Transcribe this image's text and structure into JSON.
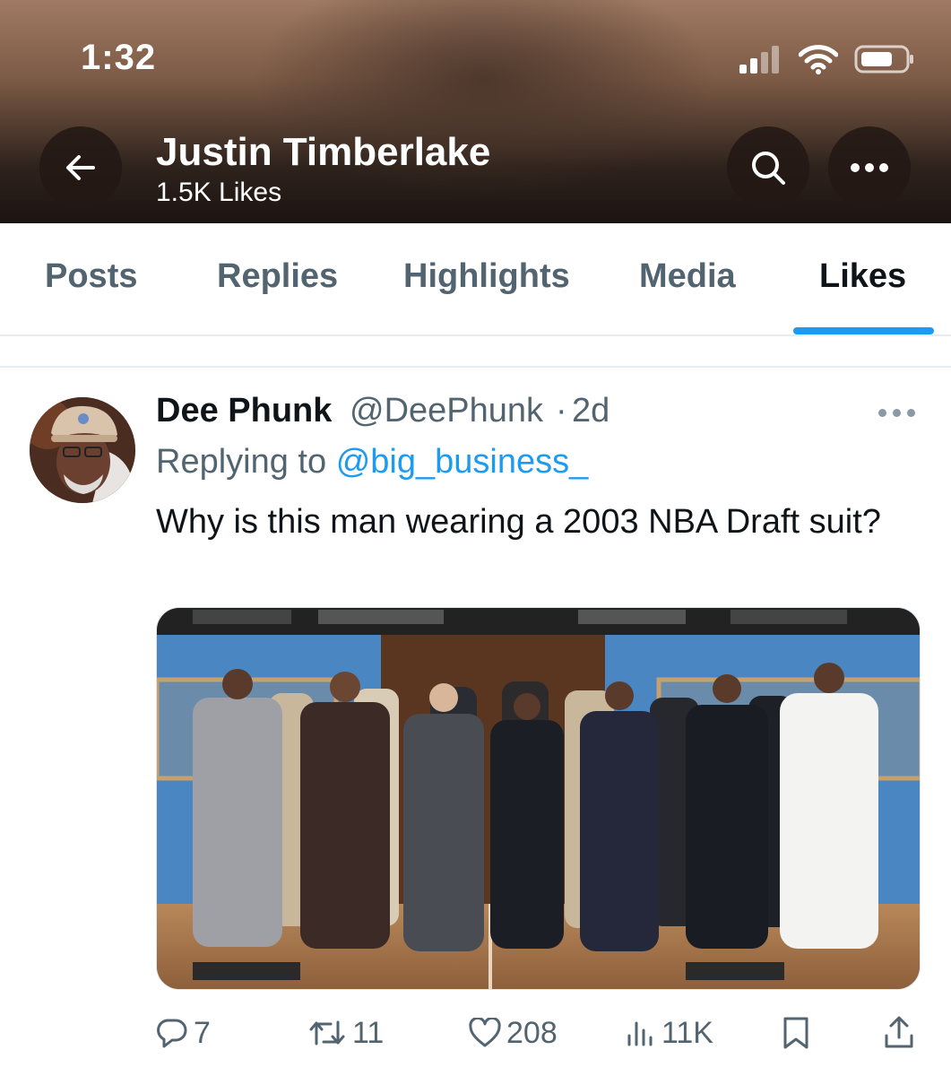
{
  "status_bar": {
    "time": "1:32"
  },
  "header": {
    "title": "Justin Timberlake",
    "subtitle": "1.5K Likes",
    "back_icon": "arrow-left-icon",
    "search_icon": "search-icon",
    "more_icon": "more-horizontal-icon"
  },
  "tabs": [
    {
      "label": "Posts"
    },
    {
      "label": "Replies"
    },
    {
      "label": "Highlights"
    },
    {
      "label": "Media"
    },
    {
      "label": "Likes",
      "active": true
    }
  ],
  "tweet": {
    "author_name": "Dee Phunk",
    "author_handle": "@DeePhunk",
    "separator": "·",
    "time": "2d",
    "replying_prefix": "Replying to",
    "replying_to": "@big_business_",
    "text": "Why is this man wearing a 2003 NBA Draft suit?",
    "media_description": "Group photo of players in suits on a basketball court",
    "actions": {
      "replies": "7",
      "reposts": "11",
      "likes": "208",
      "views": "11K"
    }
  },
  "colors": {
    "accent": "#1d9bf0",
    "text_primary": "#0f1419",
    "text_secondary": "#536471"
  }
}
